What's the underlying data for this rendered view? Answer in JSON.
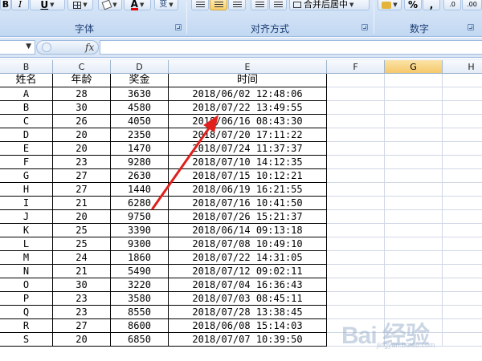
{
  "ribbon": {
    "groups": [
      {
        "label": "字体"
      },
      {
        "label": "对齐方式"
      },
      {
        "label": "数字"
      }
    ],
    "buttons": {
      "underline": "U",
      "font_color": "A",
      "phonetic": "变",
      "merge_center": "合并后居中",
      "percent": "%",
      "comma": ","
    }
  },
  "formula_bar": {
    "name_box": "",
    "fx_label": "fx",
    "formula": ""
  },
  "columns": [
    "B",
    "C",
    "D",
    "E",
    "F",
    "G",
    "H"
  ],
  "selected_column": "G",
  "table": {
    "headers": [
      "姓名",
      "年龄",
      "奖金",
      "时间"
    ],
    "rows": [
      [
        "A",
        "28",
        "3630",
        "2018/06/02 12:48:06"
      ],
      [
        "B",
        "30",
        "4580",
        "2018/07/22 13:49:55"
      ],
      [
        "C",
        "26",
        "4050",
        "2018/06/16 08:43:30"
      ],
      [
        "D",
        "20",
        "2350",
        "2018/07/20 17:11:22"
      ],
      [
        "E",
        "20",
        "1470",
        "2018/07/24 11:37:37"
      ],
      [
        "F",
        "23",
        "9280",
        "2018/07/10 14:12:35"
      ],
      [
        "G",
        "27",
        "2630",
        "2018/07/15 10:12:21"
      ],
      [
        "H",
        "27",
        "1440",
        "2018/06/19 16:21:55"
      ],
      [
        "I",
        "21",
        "6280",
        "2018/07/16 10:41:50"
      ],
      [
        "J",
        "20",
        "9750",
        "2018/07/26 15:21:37"
      ],
      [
        "K",
        "25",
        "3390",
        "2018/06/14 09:13:18"
      ],
      [
        "L",
        "25",
        "9300",
        "2018/07/08 10:49:10"
      ],
      [
        "M",
        "24",
        "1860",
        "2018/07/22 14:31:05"
      ],
      [
        "N",
        "21",
        "5490",
        "2018/07/12 09:02:11"
      ],
      [
        "O",
        "30",
        "3220",
        "2018/07/04 16:36:43"
      ],
      [
        "P",
        "23",
        "3580",
        "2018/07/03 08:45:11"
      ],
      [
        "Q",
        "23",
        "8550",
        "2018/07/28 13:38:45"
      ],
      [
        "R",
        "27",
        "8600",
        "2018/06/08 15:14:03"
      ],
      [
        "S",
        "20",
        "6850",
        "2018/07/07 10:39:50"
      ]
    ]
  },
  "annotation": {
    "color": "#e0201c"
  },
  "watermark": {
    "logo": "Bai 经验",
    "sub": "jingyan.baidu.com"
  },
  "colors": {
    "selected_header": "#f5c86a",
    "grid_line": "#d0d7e5",
    "ribbon_label": "#1d3f74"
  }
}
